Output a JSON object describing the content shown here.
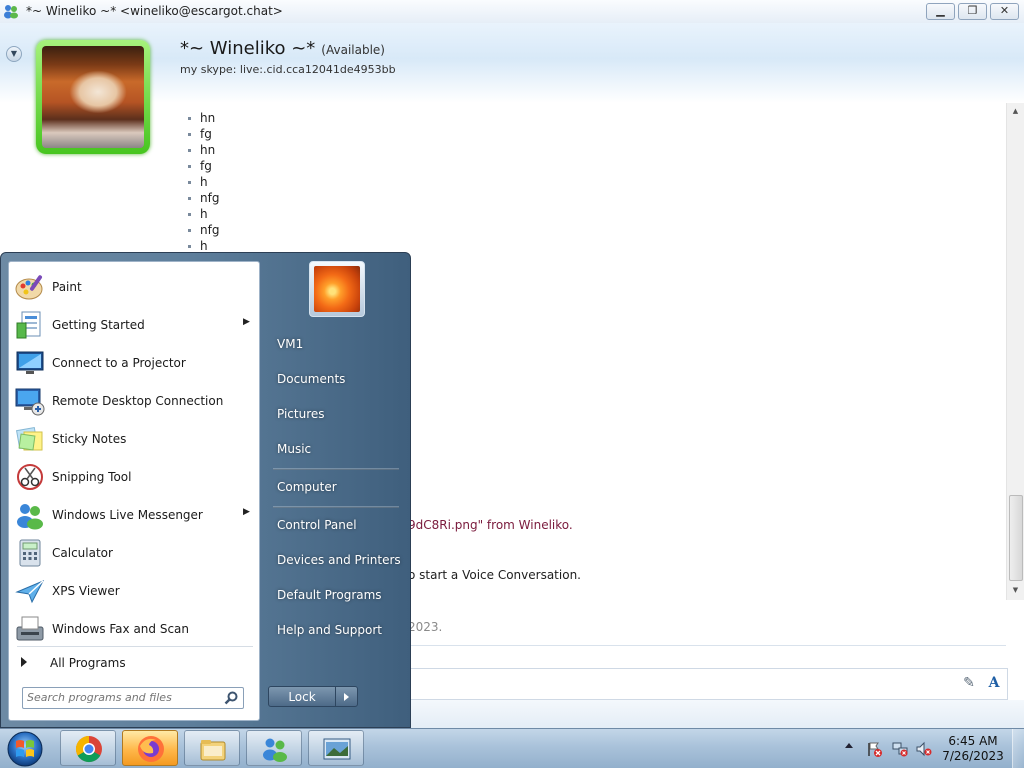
{
  "window": {
    "title": "*~ Wineliko ~* <wineliko@escargot.chat>",
    "minimize_label": "▁",
    "maximize_label": "❐",
    "close_label": "✕"
  },
  "contact": {
    "name": "*~ Wineliko ~*",
    "status": "(Available)",
    "subtitle": "my skype: live:.cid.cca12041de4953bb"
  },
  "messages": {
    "lines": [
      "hn",
      "fg",
      "hn",
      "fg",
      "h",
      "nfg",
      "h",
      "nfg",
      "h"
    ],
    "file_notice": "9dC8Ri.png\" from Wineliko.",
    "voice_notice": "o start a Voice Conversation.",
    "date_notice": "2023."
  },
  "start_menu": {
    "programs": [
      {
        "label": "Paint",
        "icon": "paint-icon",
        "has_submenu": false
      },
      {
        "label": "Getting Started",
        "icon": "getting-started-icon",
        "has_submenu": true
      },
      {
        "label": "Connect to a Projector",
        "icon": "projector-icon",
        "has_submenu": false
      },
      {
        "label": "Remote Desktop Connection",
        "icon": "remote-desktop-icon",
        "has_submenu": false
      },
      {
        "label": "Sticky Notes",
        "icon": "sticky-notes-icon",
        "has_submenu": false
      },
      {
        "label": "Snipping Tool",
        "icon": "snipping-tool-icon",
        "has_submenu": false
      },
      {
        "label": "Windows Live Messenger",
        "icon": "messenger-icon",
        "has_submenu": true
      },
      {
        "label": "Calculator",
        "icon": "calculator-icon",
        "has_submenu": false
      },
      {
        "label": "XPS Viewer",
        "icon": "xps-viewer-icon",
        "has_submenu": false
      },
      {
        "label": "Windows Fax and Scan",
        "icon": "fax-scan-icon",
        "has_submenu": false
      }
    ],
    "all_programs": "All Programs",
    "search_placeholder": "Search programs and files",
    "right_items": [
      "VM1",
      "Documents",
      "Pictures",
      "Music",
      "Computer",
      "Control Panel",
      "Devices and Printers",
      "Default Programs",
      "Help and Support"
    ],
    "lock_label": "Lock"
  },
  "taskbar": {
    "items": [
      {
        "name": "chrome-icon",
        "active": false
      },
      {
        "name": "firefox-icon",
        "active": true
      },
      {
        "name": "explorer-icon",
        "active": false
      },
      {
        "name": "messenger-icon",
        "active": false
      },
      {
        "name": "chat-window-icon",
        "active": false
      }
    ],
    "time": "6:45 AM",
    "date": "7/26/2023"
  },
  "colors": {
    "file_notice": "#7a1a3c",
    "avatar_frame": "#47c51f",
    "taskbar_active": "#ffb84a"
  }
}
